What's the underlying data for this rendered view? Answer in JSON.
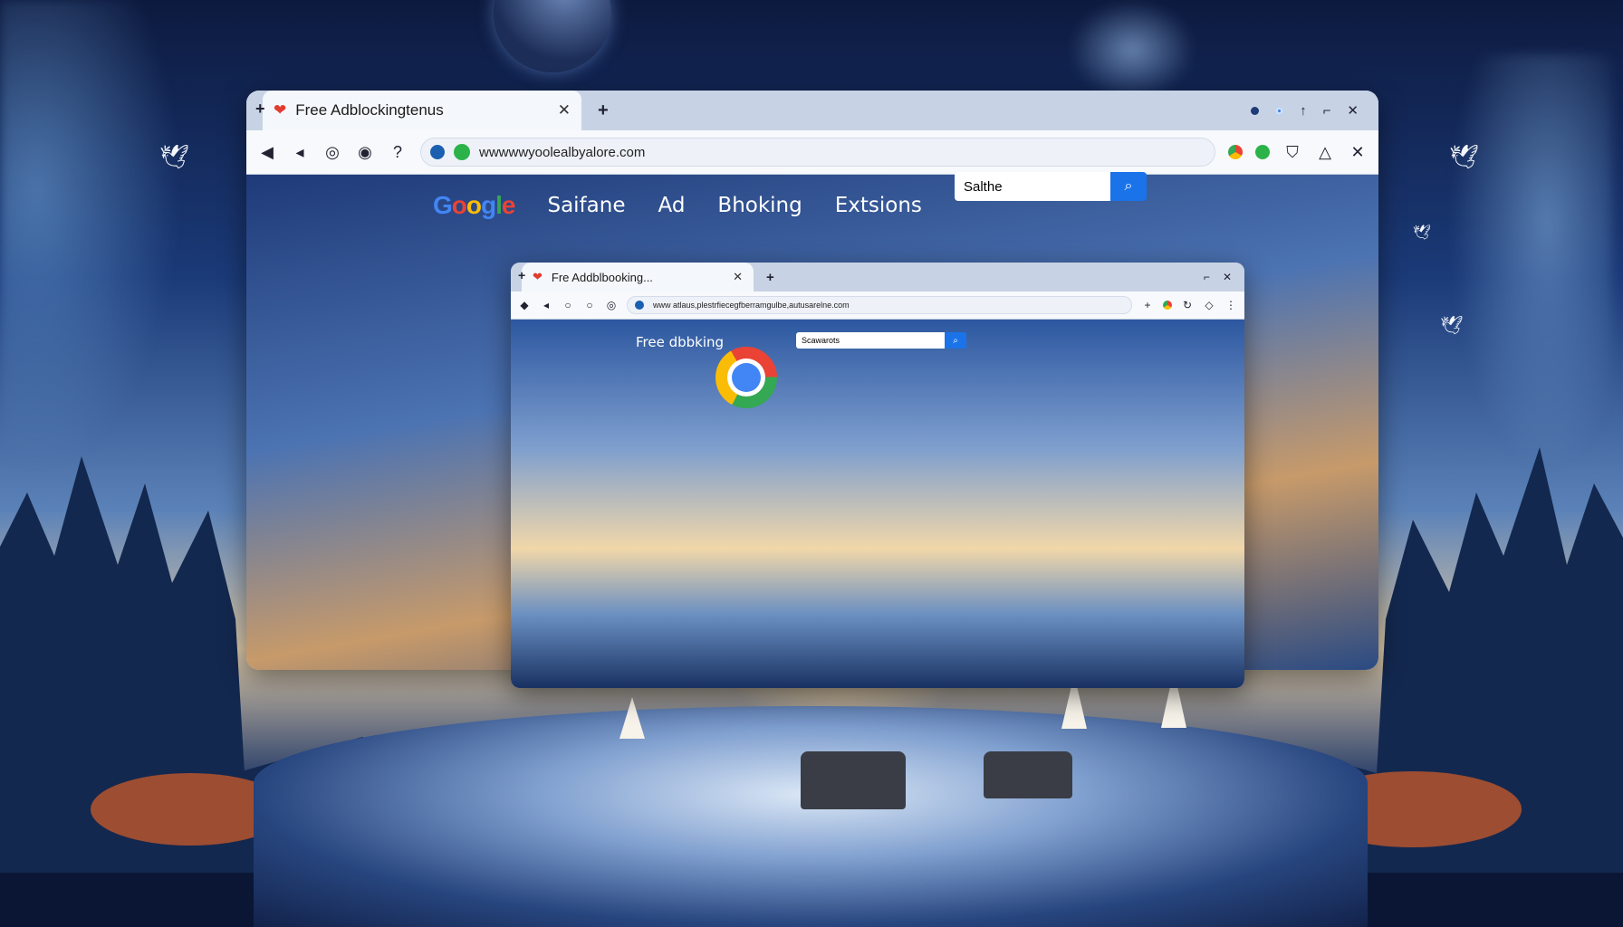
{
  "outer_browser": {
    "tab": {
      "title": "Free Adblockingtenus",
      "close": "✕"
    },
    "new_tab": "+",
    "address_url": "wwwwwyoolealbyalore.com",
    "nav": {
      "logo": "Google",
      "links": [
        "Saifane",
        "Ad",
        "Bhoking",
        "Extsions"
      ]
    },
    "search": {
      "value": "Salthe",
      "button_icon": "search-icon"
    }
  },
  "inner_browser": {
    "tab": {
      "title": "Fre Addblbooking...",
      "close": "✕"
    },
    "new_tab": "+",
    "address_url": "www atlaus,plestrfiecegfberramgulbe,autusarelne.com",
    "heading": "Free dbbking",
    "search": {
      "value": "Scawarots",
      "button_icon": "search-icon"
    }
  },
  "colors": {
    "accent": "#1a73e8",
    "heart": "#e23b2f"
  }
}
